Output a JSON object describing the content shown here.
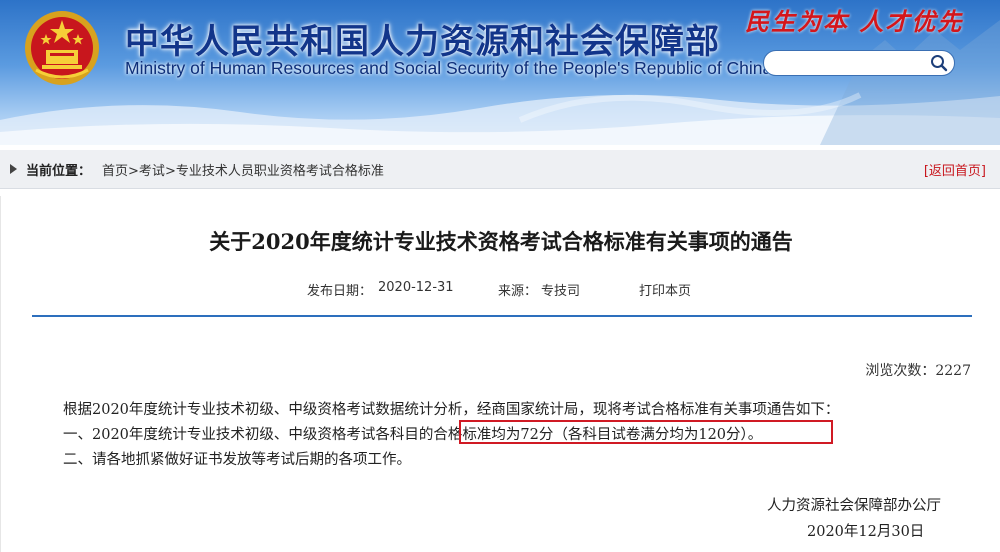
{
  "header": {
    "title_cn": "中华人民共和国人力资源和社会保障部",
    "title_en": "Ministry of Human Resources and Social Security of the People's Republic of China",
    "slogan": "民生为本 人才优先",
    "search": {
      "placeholder": "",
      "value": ""
    }
  },
  "breadcrumb": {
    "label": "当前位置：",
    "items": [
      "首页",
      "考试",
      "专业技术人员职业资格考试合格标准"
    ],
    "separator": ">",
    "back_link": "[返回首页]"
  },
  "article": {
    "title": "关于2020年度统计专业技术资格考试合格标准有关事项的通告",
    "publish_label": "发布日期：",
    "publish_date": "2020-12-31",
    "source_label": "来源：",
    "source": "专技司",
    "print_label": "打印本页",
    "views_label": "浏览次数：",
    "views": "2227",
    "paragraphs": [
      "根据2020年度统计专业技术初级、中级资格考试数据统计分析，经商国家统计局，现将考试合格标准有关事项通告如下：",
      "一、2020年度统计专业技术初级、中级资格考试各科目的合格标准均为72分（各科目试卷满分均为120分）。",
      "二、请各地抓紧做好证书发放等考试后期的各项工作。"
    ],
    "signature": "人力资源社会保障部办公厅",
    "sign_date": "2020年12月30日"
  },
  "colors": {
    "banner_top": "#2d73c8",
    "title_blue": "#12358a",
    "slogan_red": "#d4161b",
    "rule_blue": "#2d6fbd",
    "highlight_red": "#d01a24"
  }
}
